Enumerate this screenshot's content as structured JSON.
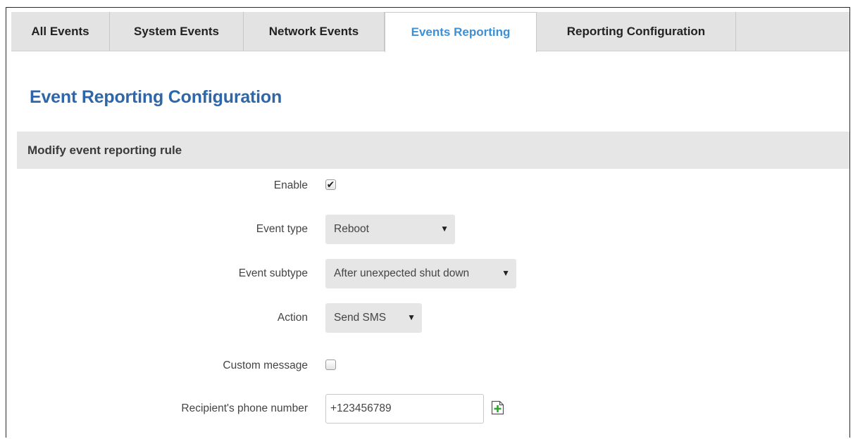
{
  "tabs": [
    {
      "label": "All Events",
      "active": false
    },
    {
      "label": "System Events",
      "active": false
    },
    {
      "label": "Network Events",
      "active": false
    },
    {
      "label": "Events Reporting",
      "active": true
    },
    {
      "label": "Reporting Configuration",
      "active": false
    }
  ],
  "page": {
    "title": "Event Reporting Configuration"
  },
  "section": {
    "title": "Modify event reporting rule"
  },
  "form": {
    "enable": {
      "label": "Enable",
      "checked": true
    },
    "event_type": {
      "label": "Event type",
      "value": "Reboot"
    },
    "event_subtype": {
      "label": "Event subtype",
      "value": "After unexpected shut down"
    },
    "action": {
      "label": "Action",
      "value": "Send SMS"
    },
    "custom_message": {
      "label": "Custom message",
      "checked": false
    },
    "recipient_phone": {
      "label": "Recipient's phone number",
      "value": "+123456789"
    }
  },
  "colors": {
    "active_tab": "#3d8fd6",
    "title": "#2f66a8",
    "section_bg": "#e6e6e6",
    "add_icon": "#2fa82f"
  },
  "icons": {
    "checkmark": "check-icon",
    "dropdown": "chevron-down-icon",
    "add": "add-icon"
  }
}
